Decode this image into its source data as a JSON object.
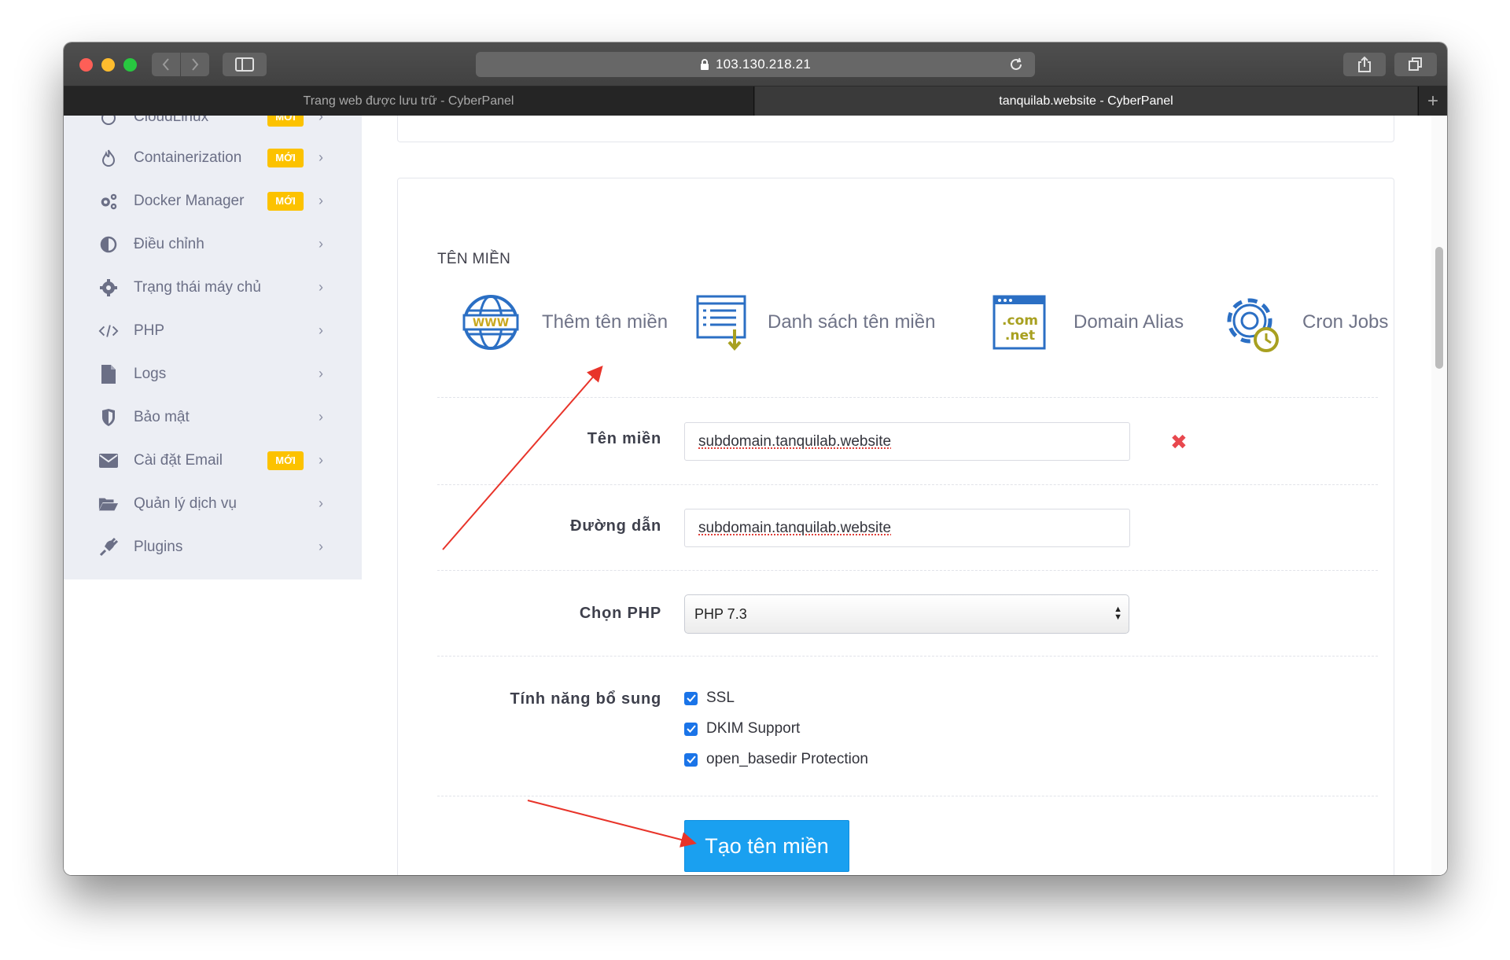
{
  "browser": {
    "url": "103.130.218.21",
    "tabs": [
      {
        "title": "Trang web được lưu trữ - CyberPanel",
        "active": false
      },
      {
        "title": "tanquilab.website - CyberPanel",
        "active": true
      }
    ]
  },
  "sidebar": {
    "items": [
      {
        "label": "CloudLinux",
        "icon": "cloud-icon",
        "badge": "MỚI"
      },
      {
        "label": "Containerization",
        "icon": "fire-icon",
        "badge": "MỚI"
      },
      {
        "label": "Docker Manager",
        "icon": "cogs-icon",
        "badge": "MỚI"
      },
      {
        "label": "Điều chỉnh",
        "icon": "contrast-icon",
        "badge": ""
      },
      {
        "label": "Trạng thái máy chủ",
        "icon": "gear-icon",
        "badge": ""
      },
      {
        "label": "PHP",
        "icon": "code-icon",
        "badge": ""
      },
      {
        "label": "Logs",
        "icon": "file-icon",
        "badge": ""
      },
      {
        "label": "Bảo mật",
        "icon": "shield-icon",
        "badge": ""
      },
      {
        "label": "Cài đặt Email",
        "icon": "envelope-icon",
        "badge": "MỚI"
      },
      {
        "label": "Quản lý dịch vụ",
        "icon": "folder-open-icon",
        "badge": ""
      },
      {
        "label": "Plugins",
        "icon": "plug-icon",
        "badge": ""
      }
    ]
  },
  "main": {
    "section_title": "TÊN MIỀN",
    "quick_links": [
      {
        "label": "Thêm tên miền",
        "icon": "www-globe-icon"
      },
      {
        "label": "Danh sách tên miền",
        "icon": "domain-list-icon"
      },
      {
        "label": "Domain Alias",
        "icon": "com-net-icon"
      },
      {
        "label": "Cron Jobs",
        "icon": "cron-gear-icon"
      }
    ],
    "form": {
      "domain_label": "Tên miền",
      "domain_value": "subdomain.tanquilab.website",
      "path_label": "Đường dẫn",
      "path_value": "subdomain.tanquilab.website",
      "php_label": "Chọn PHP",
      "php_value": "PHP 7.3",
      "features_label": "Tính năng bổ sung",
      "features": [
        {
          "label": "SSL",
          "checked": true
        },
        {
          "label": "DKIM Support",
          "checked": true
        },
        {
          "label": "open_basedir Protection",
          "checked": true
        }
      ],
      "submit_label": "Tạo tên miền"
    }
  },
  "colors": {
    "accent": "#1aa0f0",
    "badge": "#fcc200",
    "sidebar_bg": "#eceef4",
    "annotation": "#e8342a"
  }
}
